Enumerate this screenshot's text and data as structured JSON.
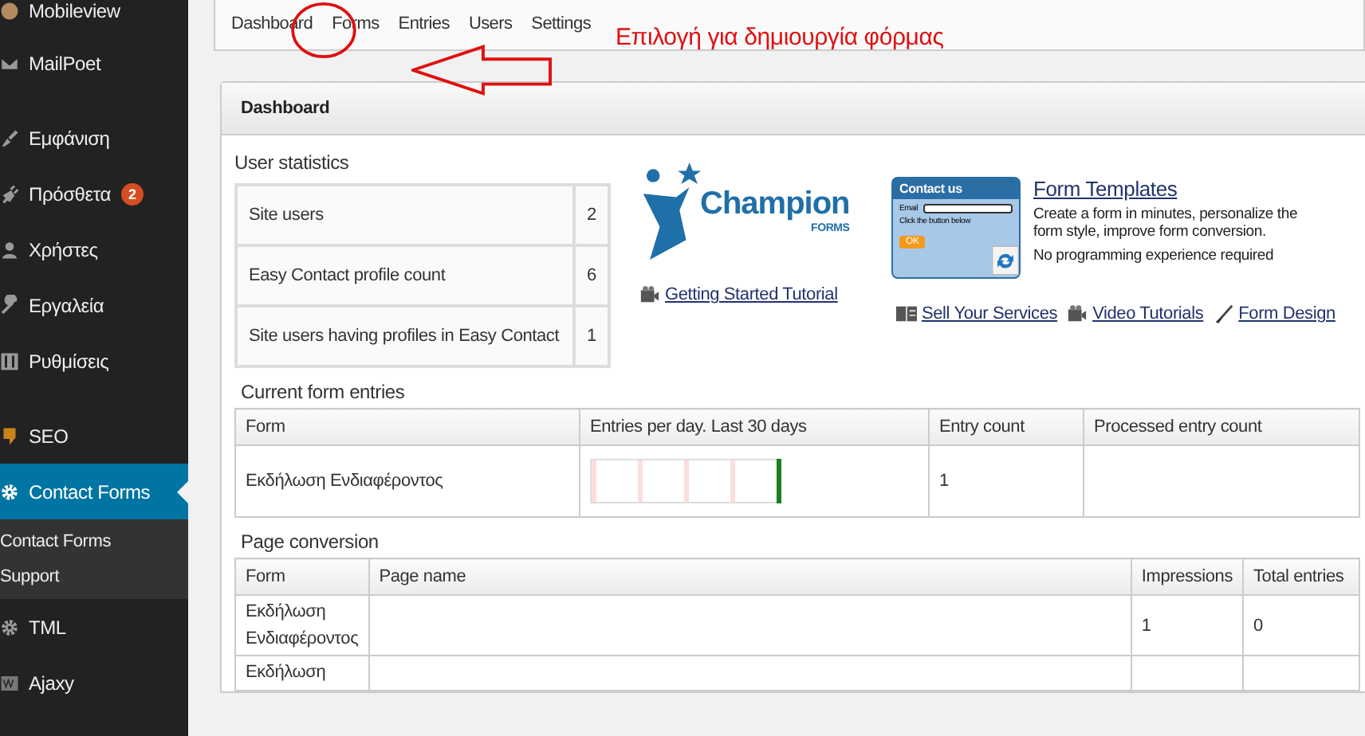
{
  "sidebar": {
    "groups": [
      [
        {
          "label": "Mobileview",
          "selected": false
        },
        {
          "label": "MailPoet",
          "selected": false
        }
      ],
      [
        {
          "label": "Εμφάνιση",
          "selected": false
        },
        {
          "label": "Πρόσθετα",
          "selected": false,
          "badge": "2"
        },
        {
          "label": "Χρήστες",
          "selected": false
        },
        {
          "label": "Εργαλεία",
          "selected": false
        },
        {
          "label": "Ρυθμίσεις",
          "selected": false
        }
      ],
      [
        {
          "label": "SEO",
          "selected": false
        },
        {
          "label": "Contact Forms",
          "selected": true,
          "children": [
            {
              "label": "Contact Forms"
            },
            {
              "label": "Support"
            }
          ]
        },
        {
          "label": "TML",
          "selected": false
        },
        {
          "label": "Ajaxy",
          "selected": false
        }
      ]
    ]
  },
  "tabs": [
    {
      "label": "Dashboard"
    },
    {
      "label": "Forms"
    },
    {
      "label": "Entries"
    },
    {
      "label": "Users"
    },
    {
      "label": "Settings"
    }
  ],
  "annotation": {
    "text": "Επιλογή για δημιουργία φόρμας"
  },
  "panel": {
    "title": "Dashboard",
    "user_statistics": {
      "title": "User statistics",
      "rows": [
        {
          "label": "Site users",
          "value": "2"
        },
        {
          "label": "Easy Contact profile count",
          "value": "6"
        },
        {
          "label": "Site users having profiles in Easy Contact",
          "value": "1"
        }
      ]
    },
    "logo": {
      "name": "Champion",
      "tagline": "FORMS"
    },
    "getting_started": "Getting Started Tutorial",
    "template_preview": {
      "title": "Contact us",
      "field_label": "Email",
      "hint": "Click the button below",
      "button": "OK"
    },
    "form_templates": {
      "title": "Form Templates",
      "description": "Create a form in minutes, personalize the form style, improve form conversion.",
      "note": "No programming experience required"
    },
    "links": [
      "Sell Your Services",
      "Video Tutorials",
      "Form Design"
    ],
    "current_entries": {
      "title": "Current form entries",
      "columns": [
        "Form",
        "Entries per day. Last 30 days",
        "Entry count",
        "Processed entry count"
      ],
      "rows": [
        {
          "form": "Εκδήλωση Ενδιαφέροντος",
          "entry_count": "1"
        }
      ]
    },
    "page_conversion": {
      "title": "Page conversion",
      "columns": [
        "Form",
        "Page name",
        "Impressions",
        "Total entries"
      ],
      "rows": [
        {
          "form": "Εκδήλωση Ενδιαφέροντος",
          "impressions": "1",
          "total_entries": "0"
        },
        {
          "form": "Εκδήλωση"
        }
      ]
    }
  }
}
